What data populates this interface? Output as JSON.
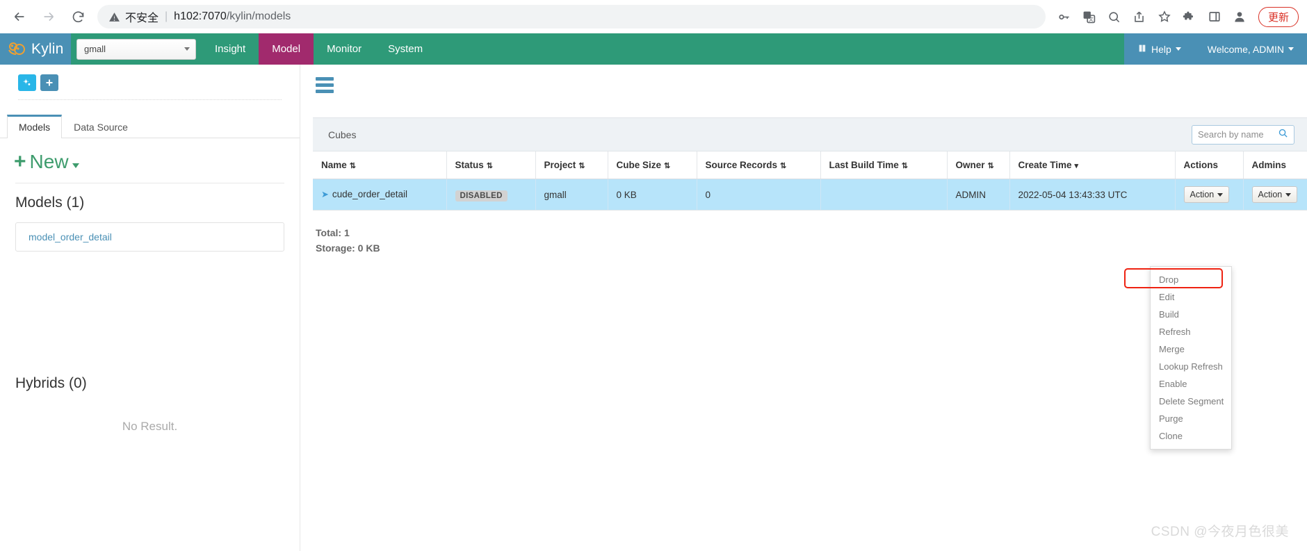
{
  "browser": {
    "back_icon": "back-arrow-icon",
    "forward_icon": "forward-arrow-icon",
    "reload_icon": "reload-icon",
    "security_label": "不安全",
    "separator": "|",
    "url_host": "h102:7070",
    "url_path": "/kylin/models",
    "toolbar_icons": [
      "key-icon",
      "translate-icon",
      "zoom-out-icon",
      "share-icon",
      "bookmark-star-icon",
      "extensions-puzzle-icon",
      "side-panel-icon",
      "profile-avatar-icon"
    ],
    "update_button": "更新"
  },
  "navbar": {
    "brand": "Kylin",
    "project_selected": "gmall",
    "items": [
      {
        "label": "Insight",
        "active": false
      },
      {
        "label": "Model",
        "active": true
      },
      {
        "label": "Monitor",
        "active": false
      },
      {
        "label": "System",
        "active": false
      }
    ],
    "help_label": "Help",
    "user_label": "Welcome, ADMIN",
    "colors": {
      "brand_bg": "#4a90b5",
      "nav_bg": "#2e9a78",
      "active_bg": "#a12a6d"
    }
  },
  "sidebar": {
    "tools": [
      {
        "name": "gears-icon",
        "title": "settings"
      },
      {
        "name": "plus-icon",
        "title": "add"
      }
    ],
    "tabs": [
      {
        "label": "Models",
        "active": true
      },
      {
        "label": "Data Source",
        "active": false
      }
    ],
    "new_button": "New",
    "models_title": "Models (1)",
    "models": [
      "model_order_detail"
    ],
    "hybrids_title": "Hybrids (0)",
    "no_result": "No Result."
  },
  "main": {
    "panel_title": "Cubes",
    "search_placeholder": "Search by name",
    "columns": [
      {
        "label": "Name",
        "sort": "both"
      },
      {
        "label": "Status",
        "sort": "both"
      },
      {
        "label": "Project",
        "sort": "both"
      },
      {
        "label": "Cube Size",
        "sort": "both"
      },
      {
        "label": "Source Records",
        "sort": "both"
      },
      {
        "label": "Last Build Time",
        "sort": "both"
      },
      {
        "label": "Owner",
        "sort": "both"
      },
      {
        "label": "Create Time",
        "sort": "desc"
      },
      {
        "label": "Actions",
        "sort": "none"
      },
      {
        "label": "Admins",
        "sort": "none"
      }
    ],
    "rows": [
      {
        "name": "cude_order_detail",
        "status": "DISABLED",
        "project": "gmall",
        "cube_size": "0 KB",
        "source_records": "0",
        "last_build_time": "",
        "owner": "ADMIN",
        "create_time": "2022-05-04 13:43:33 UTC",
        "action_label": "Action",
        "admin_action_label": "Action"
      }
    ],
    "total_label": "Total: 1",
    "storage_label": "Storage: 0 KB",
    "action_menu": [
      "Drop",
      "Edit",
      "Build",
      "Refresh",
      "Merge",
      "Lookup Refresh",
      "Enable",
      "Delete Segment",
      "Purge",
      "Clone"
    ],
    "highlighted_menu_item": "Build",
    "highlight_color": "#ee2211"
  },
  "watermark": "CSDN @今夜月色很美"
}
